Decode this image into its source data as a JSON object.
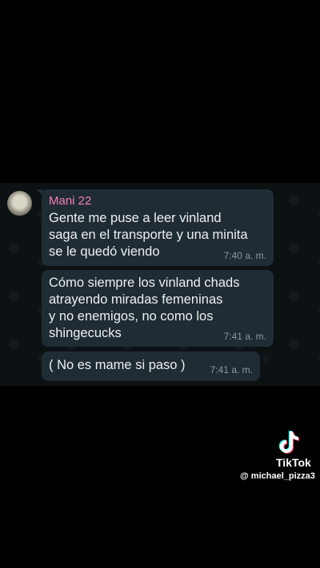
{
  "messages": [
    {
      "sender": "Mani 22",
      "text": "Gente me puse a leer vinland\nsaga en el transporte y una minita\nse le quedó viendo",
      "time": "7:40 a. m."
    },
    {
      "text": "Cómo siempre los vinland chads\natrayendo miradas femeninas\ny no enemigos, no como los\nshingecucks",
      "time": "7:41 a. m."
    },
    {
      "text": "( No es mame si paso )",
      "time": "7:41 a. m."
    }
  ],
  "watermark": {
    "brand": "TikTok",
    "username": "@ michael_pizza3",
    "icon": "tiktok-logo-icon"
  },
  "colors": {
    "background": "#000000",
    "chat_background": "#0c1114",
    "bubble": "#1f2c34",
    "sender_name": "#f77fb6",
    "message_text": "#eef0f1",
    "timestamp": "#8e979c"
  }
}
